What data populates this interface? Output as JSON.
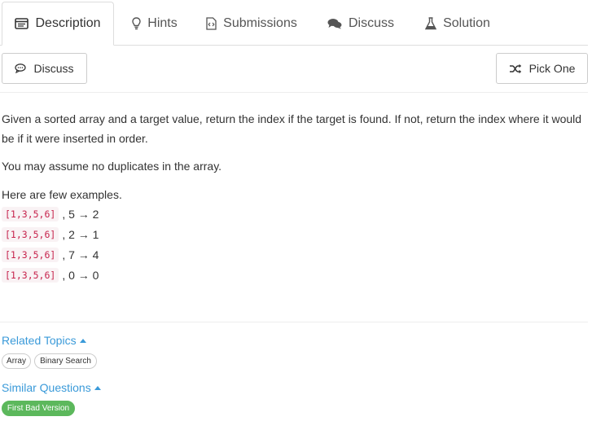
{
  "tabs": [
    {
      "label": "Description",
      "icon": "description-icon",
      "active": true
    },
    {
      "label": "Hints",
      "icon": "lightbulb-icon"
    },
    {
      "label": "Submissions",
      "icon": "code-file-icon"
    },
    {
      "label": "Discuss",
      "icon": "comments-icon"
    },
    {
      "label": "Solution",
      "icon": "flask-icon"
    }
  ],
  "toolbar": {
    "discuss_label": "Discuss",
    "pick_one_label": "Pick One"
  },
  "description": {
    "paragraph1": "Given a sorted array and a target value, return the index if the target is found. If not, return the index where it would be if it were inserted in order.",
    "paragraph2": "You may assume no duplicates in the array.",
    "examples_intro": "Here are few examples.",
    "examples": [
      {
        "code": "[1,3,5,6]",
        "rest": ", 5 → 2"
      },
      {
        "code": "[1,3,5,6]",
        "rest": ", 2 → 1"
      },
      {
        "code": "[1,3,5,6]",
        "rest": ", 7 → 4"
      },
      {
        "code": "[1,3,5,6]",
        "rest": ", 0 → 0"
      }
    ]
  },
  "related_topics": {
    "label": "Related Topics",
    "tags": [
      "Array",
      "Binary Search"
    ]
  },
  "similar_questions": {
    "label": "Similar Questions",
    "tags": [
      "First Bad Version"
    ]
  },
  "colors": {
    "link": "#3a9ad9",
    "code_text": "#c7254e",
    "code_bg": "#f9f2f4",
    "tag_green": "#5cb85c"
  }
}
